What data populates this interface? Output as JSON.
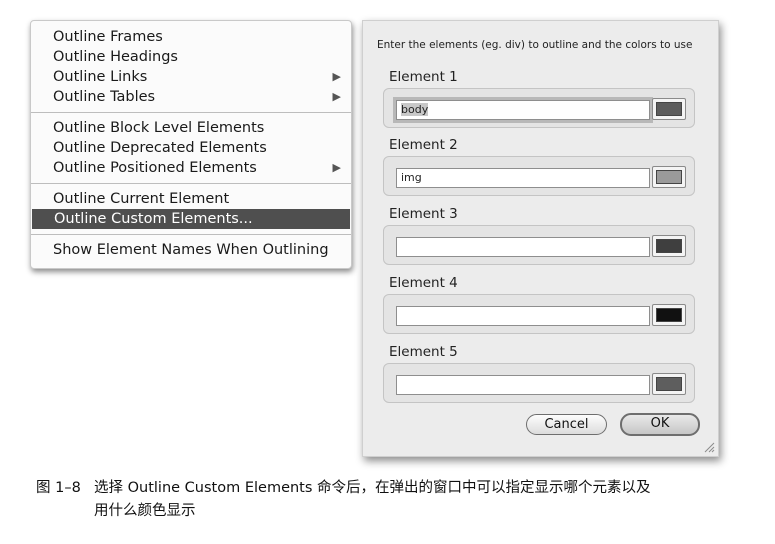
{
  "menu": {
    "groups": [
      [
        {
          "label": "Outline Frames",
          "submenu": false
        },
        {
          "label": "Outline Headings",
          "submenu": false
        },
        {
          "label": "Outline Links",
          "submenu": true
        },
        {
          "label": "Outline Tables",
          "submenu": true
        }
      ],
      [
        {
          "label": "Outline Block Level Elements",
          "submenu": false
        },
        {
          "label": "Outline Deprecated Elements",
          "submenu": false
        },
        {
          "label": "Outline Positioned Elements",
          "submenu": true
        }
      ],
      [
        {
          "label": "Outline Current Element",
          "submenu": false
        },
        {
          "label": "Outline Custom Elements...",
          "submenu": false,
          "selected": true
        }
      ],
      [
        {
          "label": "Show Element Names When Outlining",
          "submenu": false
        }
      ]
    ],
    "submenu_arrow": "▶"
  },
  "dialog": {
    "instruction": "Enter the elements (eg. div) to outline and the colors to use",
    "elements": [
      {
        "label": "Element 1",
        "value": "body",
        "color": "#5c5c5c",
        "focused": true
      },
      {
        "label": "Element 2",
        "value": "img",
        "color": "#9a9a9a",
        "focused": false
      },
      {
        "label": "Element 3",
        "value": "",
        "color": "#3f3f3f",
        "focused": false
      },
      {
        "label": "Element 4",
        "value": "",
        "color": "#111111",
        "focused": false
      },
      {
        "label": "Element 5",
        "value": "",
        "color": "#5e5e5e",
        "focused": false
      }
    ],
    "cancel_label": "Cancel",
    "ok_label": "OK"
  },
  "caption": {
    "figure_number": "图 1–8",
    "line1": "选择 Outline Custom Elements 命令后，在弹出的窗口中可以指定显示哪个元素以及",
    "line2": "用什么颜色显示"
  }
}
